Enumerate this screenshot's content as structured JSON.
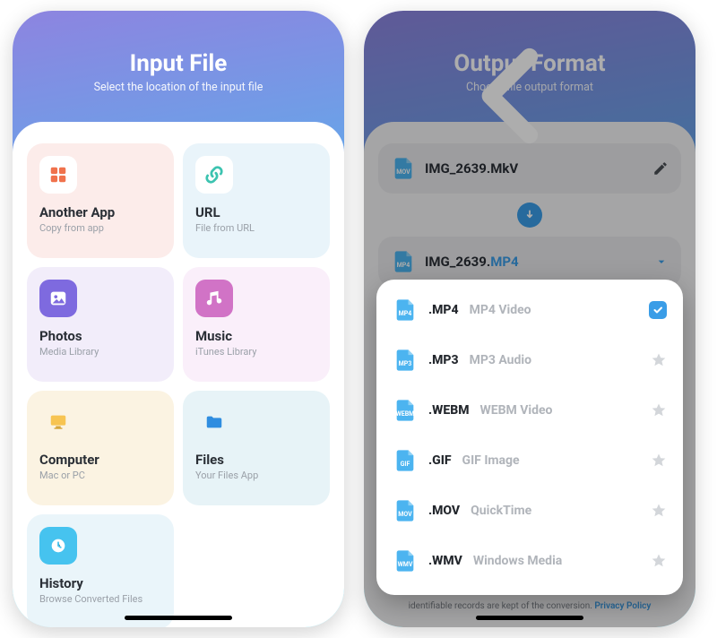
{
  "left": {
    "title": "Input File",
    "subtitle": "Select the location of the input file",
    "cards": {
      "app": {
        "title": "Another App",
        "sub": "Copy from app"
      },
      "url": {
        "title": "URL",
        "sub": "File from URL"
      },
      "photos": {
        "title": "Photos",
        "sub": "Media Library"
      },
      "music": {
        "title": "Music",
        "sub": "iTunes Library"
      },
      "computer": {
        "title": "Computer",
        "sub": "Mac or PC"
      },
      "files": {
        "title": "Files",
        "sub": "Your Files App"
      },
      "history": {
        "title": "History",
        "sub": "Browse Converted Files"
      }
    }
  },
  "right": {
    "title": "Output Format",
    "subtitle": "Choose file output format",
    "source": {
      "name": "IMG_2639.MkV",
      "tag": "MOV"
    },
    "target": {
      "name": "IMG_2639.",
      "ext": "MP4",
      "tag": "MP4"
    },
    "formats": [
      {
        "ext": ".MP4",
        "desc": "MP4 Video",
        "tag": "MP4",
        "selected": true
      },
      {
        "ext": ".MP3",
        "desc": "MP3 Audio",
        "tag": "MP3",
        "selected": false
      },
      {
        "ext": ".WEBM",
        "desc": "WEBM Video",
        "tag": "WEBM",
        "selected": false
      },
      {
        "ext": ".GIF",
        "desc": "GIF Image",
        "tag": "GIF",
        "selected": false
      },
      {
        "ext": ".MOV",
        "desc": "QuickTime",
        "tag": "MOV",
        "selected": false
      },
      {
        "ext": ".WMV",
        "desc": "Windows Media",
        "tag": "WMV",
        "selected": false
      }
    ],
    "policy_pre": "identifiable records are kept of the conversion. ",
    "policy_link": "Privacy Policy"
  }
}
